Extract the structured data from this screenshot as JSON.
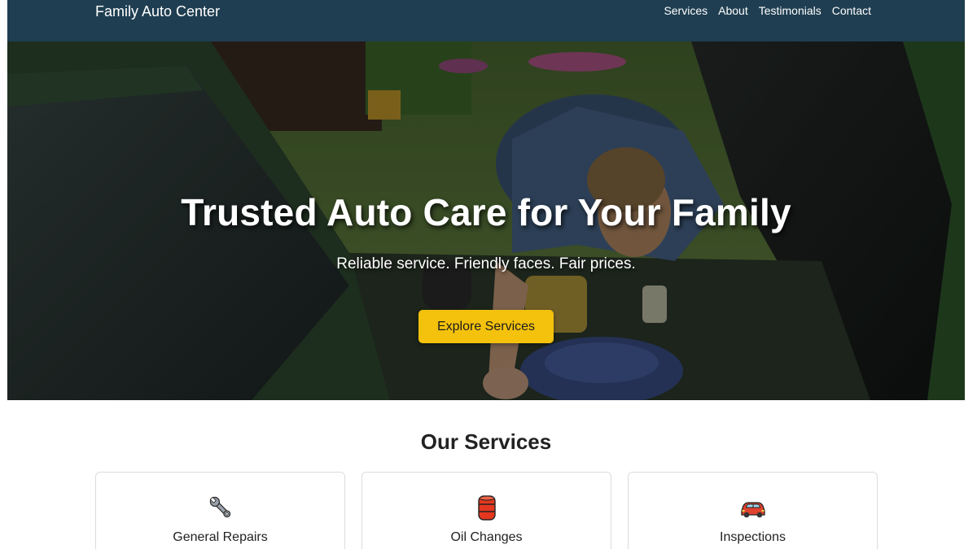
{
  "navbar": {
    "brand": "Family Auto Center",
    "links": [
      "Services",
      "About",
      "Testimonials",
      "Contact"
    ]
  },
  "hero": {
    "title": "Trusted Auto Care for Your Family",
    "subtitle": "Reliable service. Friendly faces. Fair prices.",
    "cta_label": "Explore Services"
  },
  "services": {
    "title": "Our Services",
    "cards": [
      {
        "title": "General Repairs",
        "icon": "wrench-icon"
      },
      {
        "title": "Oil Changes",
        "icon": "oil-drum-icon"
      },
      {
        "title": "Inspections",
        "icon": "car-icon"
      }
    ]
  },
  "colors": {
    "navbar_bg": "#1f3e51",
    "cta_bg": "#f4c20d",
    "text_dark": "#222222"
  }
}
